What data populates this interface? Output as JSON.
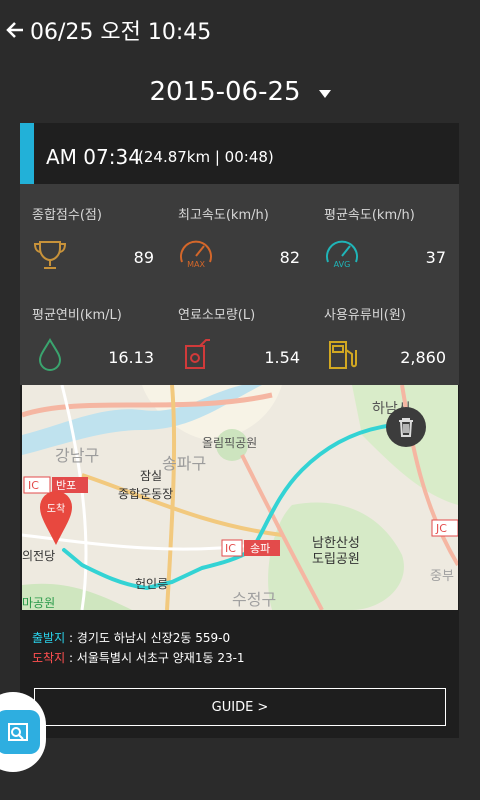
{
  "header": {
    "title": "06/25 오전 10:45"
  },
  "date_selector": {
    "date": "2015-06-25"
  },
  "trip": {
    "time": "AM 07:34",
    "meta": "(24.87km | 00:48)"
  },
  "stats": [
    {
      "label": "종합점수(점)",
      "value": "89",
      "icon": "trophy-icon",
      "color": "#c7923a"
    },
    {
      "label": "최고속도(km/h)",
      "value": "82",
      "icon": "max-speed-gauge-icon",
      "color": "#d4672a",
      "icon_text": "MAX"
    },
    {
      "label": "평균속도(km/h)",
      "value": "37",
      "icon": "avg-speed-gauge-icon",
      "color": "#1fb5b8",
      "icon_text": "AVG"
    },
    {
      "label": "평균연비(km/L)",
      "value": "16.13",
      "icon": "fuel-drop-icon",
      "color": "#3aa46e"
    },
    {
      "label": "연료소모량(L)",
      "value": "1.54",
      "icon": "fuel-can-icon",
      "color": "#d13a3a"
    },
    {
      "label": "사용유류비(원)",
      "value": "2,860",
      "icon": "gas-station-icon",
      "color": "#d2a822"
    }
  ],
  "map": {
    "labels": [
      "올림픽공원",
      "강남구",
      "송파구",
      "잠실",
      "종합운동장",
      "반포",
      "남한산성",
      "도립공원",
      "송파",
      "헌인릉",
      "수정구",
      "하남시",
      "도착",
      "IC",
      "중부",
      "JC",
      "마공원",
      "의전당"
    ],
    "arrival_pin_label": "도착",
    "route_color": "#33d3d4"
  },
  "addresses": {
    "start_key": "출발지",
    "start_value": " : 경기도 하남시 신장2동 559-0",
    "end_key": "도착지",
    "end_value": " : 서울특별시 서초구 양재1동 23-1"
  },
  "buttons": {
    "guide": "GUIDE >"
  }
}
